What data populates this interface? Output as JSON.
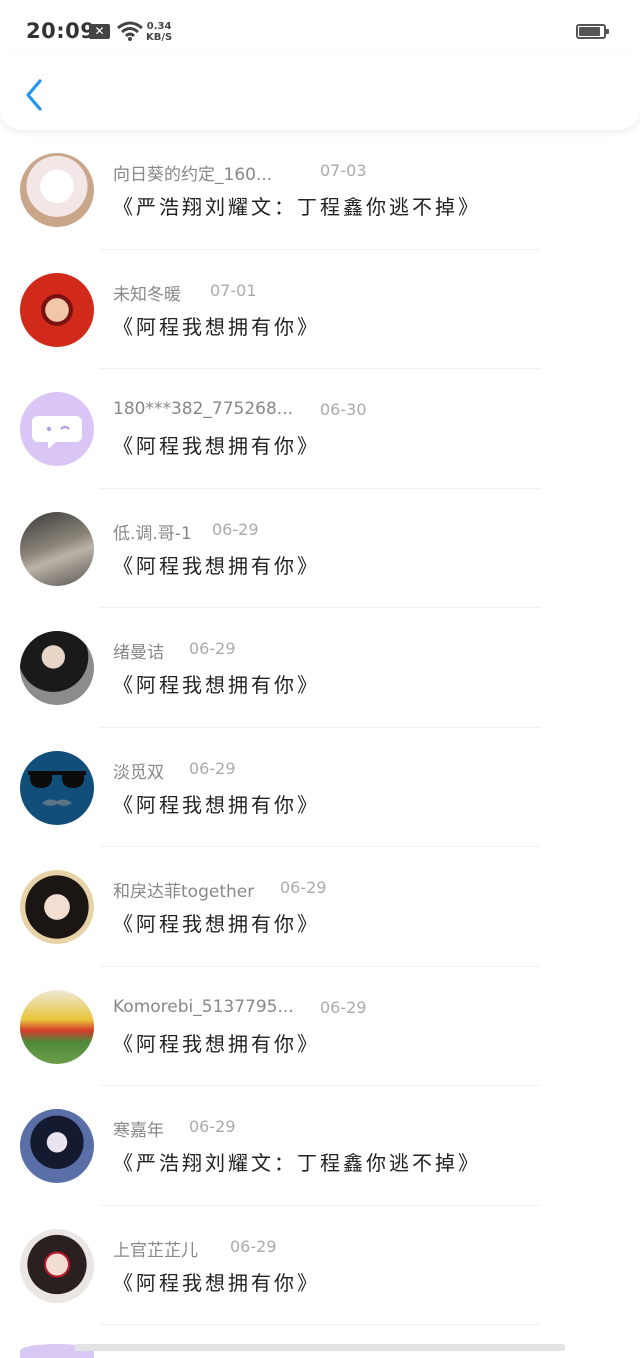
{
  "status_bar": {
    "time": "20:09",
    "net_speed_top": "0.34",
    "net_speed_bottom": "KB/S"
  },
  "accent_color": "#2196f3",
  "comments": [
    {
      "name": "向日葵的约定_160...",
      "date": "07-03",
      "message": "《严浩翔刘耀文：丁程鑫你逃不掉》",
      "avatar": "white-cat-photo"
    },
    {
      "name": "未知冬暖",
      "date": "07-01",
      "message": "《阿程我想拥有你》",
      "avatar": "red-costume-girl-photo"
    },
    {
      "name": "180***382_775268...",
      "date": "06-30",
      "message": "《阿程我想拥有你》",
      "avatar": "default-chat-bubble-avatar"
    },
    {
      "name": "低.调.哥-1",
      "date": "06-29",
      "message": "《阿程我想拥有你》",
      "avatar": "street-photo"
    },
    {
      "name": "绪曼诘",
      "date": "06-29",
      "message": "《阿程我想拥有你》",
      "avatar": "woman-black-dress-photo"
    },
    {
      "name": "淡觅双",
      "date": "06-29",
      "message": "《阿程我想拥有你》",
      "avatar": "sunglasses-mustache-avatar"
    },
    {
      "name": "和戾达菲together",
      "date": "06-29",
      "message": "《阿程我想拥有你》",
      "avatar": "girl-portrait-photo"
    },
    {
      "name": "Komorebi_5137795...",
      "date": "06-29",
      "message": "《阿程我想拥有你》",
      "avatar": "anime-character-field"
    },
    {
      "name": "寒嘉年",
      "date": "06-29",
      "message": "《严浩翔刘耀文：丁程鑫你逃不掉》",
      "avatar": "anime-girl-dark"
    },
    {
      "name": "上官芷芷儿",
      "date": "06-29",
      "message": "《阿程我想拥有你》",
      "avatar": "woman-red-lips-photo"
    }
  ]
}
